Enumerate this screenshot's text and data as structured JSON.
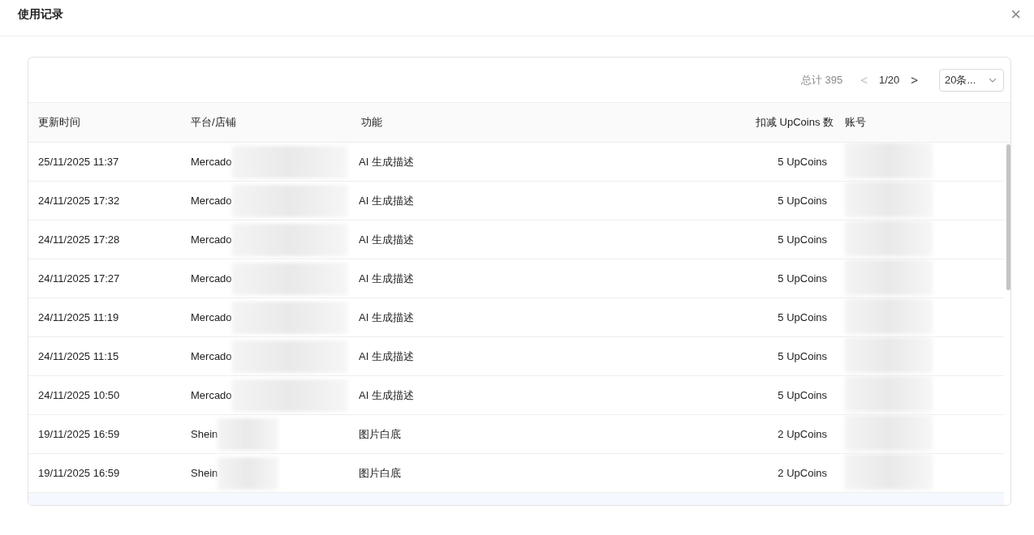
{
  "dialog": {
    "title": "使用记录",
    "close": "×"
  },
  "pagination": {
    "total": "总计 395",
    "prev": "<",
    "page": "1/20",
    "next": ">",
    "page_size": "20条..."
  },
  "table": {
    "columns": [
      "更新时间",
      "平台/店铺",
      "功能",
      "扣减 UpCoins 数",
      "账号"
    ],
    "rows": [
      {
        "time": "25/11/2025 11:37",
        "platform": "Mercado",
        "feature": "AI 生成描述",
        "coins": "5 UpCoins"
      },
      {
        "time": "24/11/2025 17:32",
        "platform": "Mercado",
        "feature": "AI 生成描述",
        "coins": "5 UpCoins"
      },
      {
        "time": "24/11/2025 17:28",
        "platform": "Mercado",
        "feature": "AI 生成描述",
        "coins": "5 UpCoins"
      },
      {
        "time": "24/11/2025 17:27",
        "platform": "Mercado",
        "feature": "AI 生成描述",
        "coins": "5 UpCoins"
      },
      {
        "time": "24/11/2025 11:19",
        "platform": "Mercado",
        "feature": "AI 生成描述",
        "coins": "5 UpCoins"
      },
      {
        "time": "24/11/2025 11:15",
        "platform": "Mercado",
        "feature": "AI 生成描述",
        "coins": "5 UpCoins"
      },
      {
        "time": "24/11/2025 10:50",
        "platform": "Mercado",
        "feature": "AI 生成描述",
        "coins": "5 UpCoins"
      },
      {
        "time": "19/11/2025 16:59",
        "platform": "Shein",
        "feature": "图片白底",
        "coins": "2 UpCoins"
      },
      {
        "time": "19/11/2025 16:59",
        "platform": "Shein",
        "feature": "图片白底",
        "coins": "2 UpCoins"
      }
    ]
  }
}
